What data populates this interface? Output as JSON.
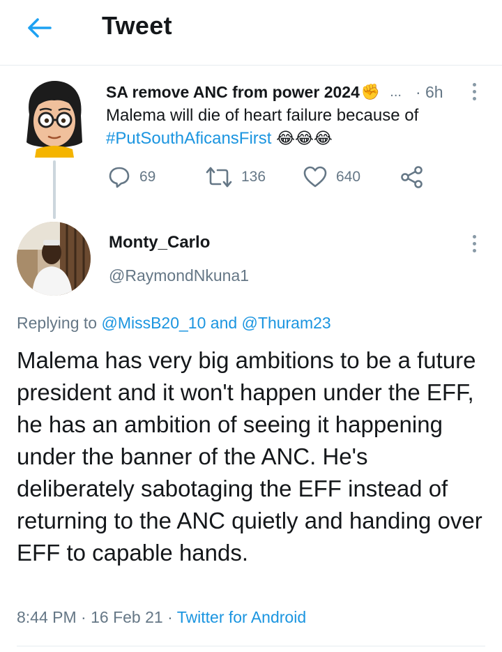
{
  "header": {
    "title": "Tweet",
    "back_icon": "arrow-left-icon",
    "accent_color": "#1da1f2"
  },
  "parent_tweet": {
    "author_name": "SA remove ANC from power 2024",
    "author_badge_emoji": "✊",
    "truncation": "...",
    "time": "· 6h",
    "text": "Malema will die of heart failure because of",
    "hashtag": "#PutSouthAficansFirst",
    "emojis": "😂😂😂",
    "actions": {
      "reply_count": "69",
      "retweet_count": "136",
      "like_count": "640"
    }
  },
  "main_tweet": {
    "author_name": "Monty_Carlo",
    "handle": "@RaymondNkuna1",
    "replying_prefix": "Replying to",
    "replying_user_1": "@MissB20_10",
    "replying_and": "and",
    "replying_user_2": "@Thuram23",
    "text": "Malema has very big ambitions to be a future president and it won't happen under the EFF, he has an ambition of seeing it happening under the banner of the ANC. He's deliberately sabotaging the EFF instead of returning to the ANC quietly and handing over EFF to capable hands.",
    "time": "8:44 PM",
    "date_separator": "·",
    "date": "16 Feb 21",
    "source_separator": "·",
    "source": "Twitter for Android"
  },
  "colors": {
    "link": "#1b95e0",
    "secondary_text": "#657786",
    "divider": "#e6ecf0"
  }
}
